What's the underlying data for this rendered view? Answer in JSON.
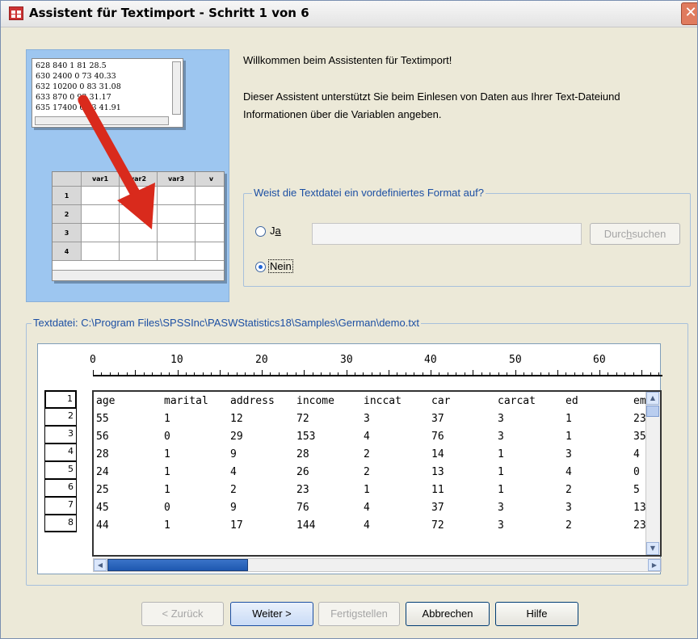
{
  "window": {
    "title": "Assistent für Textimport - Schritt 1 von 6",
    "close_glyph": "✕"
  },
  "illustration": {
    "text_lines": [
      "628 840 1 81 28.5",
      "630 2400 0 73 40.33",
      "632 10200 0 83 31.08",
      "633 870 0 93 31.17",
      "635 17400 0 83 41.91"
    ],
    "columns": [
      "var1",
      "var2",
      "var3",
      "v"
    ],
    "rows": [
      "1",
      "2",
      "3",
      "4"
    ],
    "arrow_color": "#d92a1c"
  },
  "intro": {
    "welcome": "Willkommen beim Assistenten für Textimport!",
    "description": "Dieser Assistent unterstützt Sie beim Einlesen von Daten aus Ihrer Text-Dateiund Informationen über die Variablen angeben."
  },
  "format_group": {
    "legend": "Weist die Textdatei ein vordefiniertes Format auf?",
    "option_yes": {
      "prefix": "J",
      "mnemonic": "a",
      "checked": false
    },
    "option_no": {
      "label": "Nein",
      "checked": true
    },
    "path_value": "",
    "browse": {
      "prefix": "Durc",
      "mnemonic": "h",
      "suffix": "suchen",
      "enabled": false
    }
  },
  "preview": {
    "legend": "Textdatei: C:\\Program Files\\SPSSInc\\PASWStatistics18\\Samples\\German\\demo.txt",
    "ruler_labels": [
      "0",
      "10",
      "20",
      "30",
      "40",
      "50",
      "60"
    ],
    "row_numbers": [
      "1",
      "2",
      "3",
      "4",
      "5",
      "6",
      "7",
      "8"
    ],
    "rows": [
      [
        "age",
        "marital",
        "address",
        "income",
        "inccat",
        "car",
        "carcat",
        "ed",
        "emp"
      ],
      [
        "55",
        "1",
        "12",
        "72",
        "3",
        "37",
        "3",
        "1",
        "23"
      ],
      [
        "56",
        "0",
        "29",
        "153",
        "4",
        "76",
        "3",
        "1",
        "35"
      ],
      [
        "28",
        "1",
        "9",
        "28",
        "2",
        "14",
        "1",
        "3",
        "4"
      ],
      [
        "24",
        "1",
        "4",
        "26",
        "2",
        "13",
        "1",
        "4",
        "0"
      ],
      [
        "25",
        "1",
        "2",
        "23",
        "1",
        "11",
        "1",
        "2",
        "5"
      ],
      [
        "45",
        "0",
        "9",
        "76",
        "4",
        "37",
        "3",
        "3",
        "13"
      ],
      [
        "44",
        "1",
        "17",
        "144",
        "4",
        "72",
        "3",
        "2",
        "23"
      ]
    ]
  },
  "buttons": {
    "back": {
      "label": "< Zurück",
      "enabled": false
    },
    "next": {
      "label": "Weiter >",
      "enabled": true
    },
    "finish": {
      "label": "Fertigstellen",
      "enabled": false
    },
    "cancel": {
      "label": "Abbrechen",
      "enabled": true
    },
    "help": {
      "label": "Hilfe",
      "enabled": true
    }
  },
  "colors": {
    "group_border": "#a7c0dc",
    "legend_text": "#1c4fa3",
    "scroll_thumb": "#1e58b0"
  }
}
